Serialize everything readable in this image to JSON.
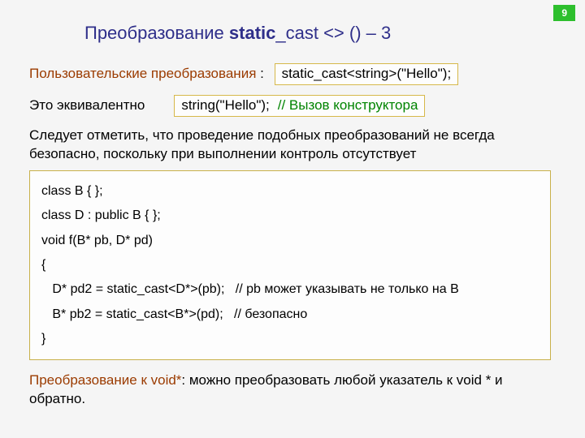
{
  "page_number": "9",
  "title": {
    "pre": "Преобразование ",
    "bold": "static",
    "rest": "_cast <> () – 3"
  },
  "line1": {
    "label": "Пользовательские преобразования",
    "colon": " : ",
    "code": "static_cast<string>(\"Hello\");"
  },
  "line2": {
    "label": "Это эквивалентно",
    "code": "string(\"Hello\");",
    "comment": "// Вызов конструктора"
  },
  "para1": "Следует отметить, что проведение подобных преобразований не всегда безопасно, поскольку при выполнении контроль отсутствует",
  "code": {
    "l1": "class B { };",
    "l2": "class D : public B { };",
    "l3": "void f(B* pb, D* pd)",
    "l4": "{",
    "l5a": "D* pd2 = static_cast<D*>(pb);",
    "l5b": "// pb может указывать не только на B",
    "l6a": "B* pb2 = static_cast<B*>(pd);",
    "l6b": "// безопасно",
    "l7": "}"
  },
  "bottom": {
    "part1": "Преобразование к void*",
    "part2": ": можно преобразовать любой указатель к void * и обратно."
  }
}
